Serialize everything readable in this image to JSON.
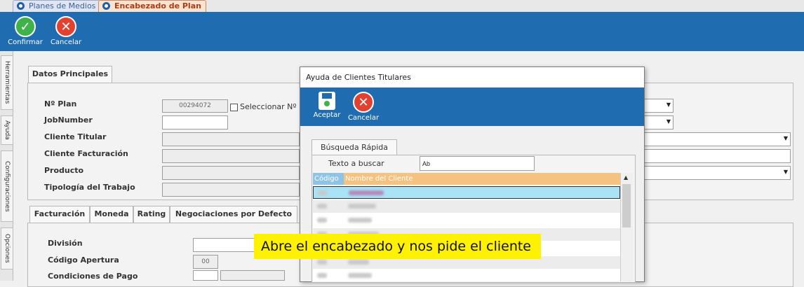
{
  "tabs": [
    {
      "label": "Planes de Medios"
    },
    {
      "label": "Encabezado de Plan"
    }
  ],
  "toolbar": {
    "confirm_label": "Confirmar",
    "cancel_label": "Cancelar"
  },
  "side_tabs": [
    "Herramientas",
    "Ayuda",
    "Configuraciones",
    "Opciones"
  ],
  "datos": {
    "tab_label": "Datos Principales",
    "plan_label": "Nº Plan",
    "plan_value": "00294072",
    "select_label": "Seleccionar Nº",
    "jobnumber_label": "JobNumber",
    "cliente_titular_label": "Cliente Titular",
    "cliente_facturacion_label": "Cliente Facturación",
    "producto_label": "Producto",
    "tipologia_label": "Tipología del Trabajo"
  },
  "bottom": {
    "tabs": [
      "Facturación",
      "Moneda",
      "Rating",
      "Negociaciones por Defecto"
    ],
    "division_label": "División",
    "codigo_apertura_label": "Código Apertura",
    "codigo_apertura_value": "00",
    "condiciones_label": "Condiciones de Pago"
  },
  "dialog": {
    "title": "Ayuda de Clientes Titulares",
    "accept_label": "Aceptar",
    "cancel_label": "Cancelar",
    "search_tab": "Búsqueda Rápida",
    "search_label": "Texto a buscar",
    "search_value": "Ab",
    "col_code": "Código",
    "col_name": "Nombre del Cliente"
  },
  "caption": "Abre el encabezado y nos pide el cliente",
  "colors": {
    "toolbar": "#1f6cb0",
    "caption_bg": "#fff200",
    "grid_header": "#f5c27f",
    "selected_row": "#a9e3f5"
  }
}
